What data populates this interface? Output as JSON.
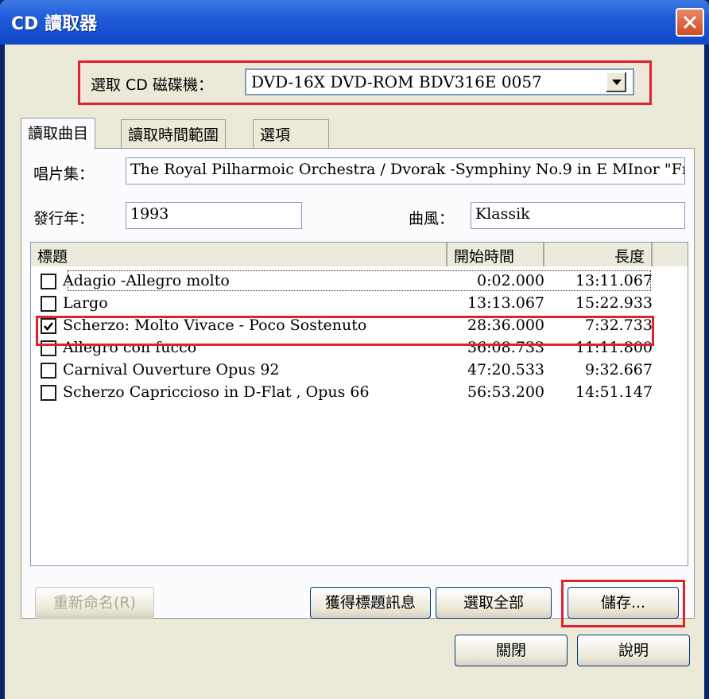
{
  "window": {
    "title": "CD 讀取器"
  },
  "drive": {
    "label": "選取 CD 磁碟機：",
    "selected": "DVD-16X DVD-ROM BDV316E 0057"
  },
  "tabs": [
    {
      "label": "讀取曲目"
    },
    {
      "label": "讀取時間範圍"
    },
    {
      "label": "選項"
    }
  ],
  "album": {
    "label": "唱片集：",
    "value": "The Royal Pilharmoic Orchestra / Dvorak -Symphiny No.9 in E MInor \"Fr"
  },
  "year": {
    "label": "發行年：",
    "value": "1993"
  },
  "genre": {
    "label": "曲風：",
    "value": "Klassik"
  },
  "tracklist": {
    "columns": [
      "標題",
      "開始時間",
      "長度"
    ],
    "rows": [
      {
        "title": "Adagio -Allegro molto",
        "start": "0:02.000",
        "length": "13:11.067",
        "checked": false
      },
      {
        "title": "Largo",
        "start": "13:13.067",
        "length": "15:22.933",
        "checked": false
      },
      {
        "title": "Scherzo: Molto Vivace - Poco Sostenuto",
        "start": "28:36.000",
        "length": "7:32.733",
        "checked": true
      },
      {
        "title": "Allegro con fucco",
        "start": "36:08.733",
        "length": "11:11.800",
        "checked": false
      },
      {
        "title": "Carnival Ouverture Opus 92",
        "start": "47:20.533",
        "length": "9:32.667",
        "checked": false
      },
      {
        "title": "Scherzo Capriccioso in D-Flat , Opus 66",
        "start": "56:53.200",
        "length": "14:51.147",
        "checked": false
      }
    ]
  },
  "buttons": {
    "rename": "重新命名(R)",
    "get_titles": "獲得標題訊息",
    "select_all": "選取全部",
    "save": "儲存...",
    "close": "關閉",
    "help": "說明"
  },
  "colors": {
    "titlebar": "#1f5bd8",
    "highlight": "#e0212e",
    "face": "#ece9d8"
  }
}
